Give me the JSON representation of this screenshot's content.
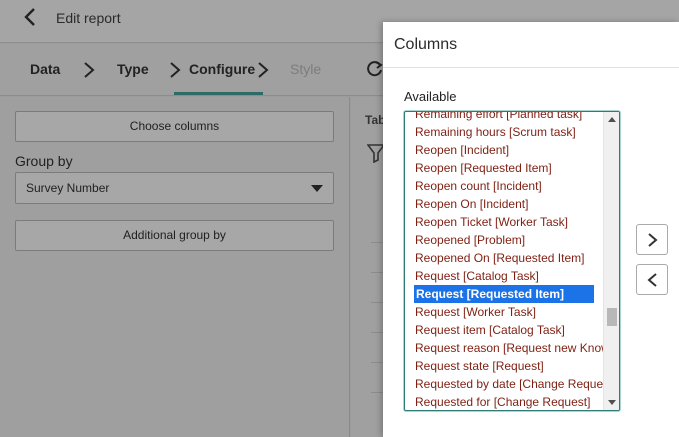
{
  "header": {
    "title": "Edit report"
  },
  "wizard": {
    "steps": [
      {
        "label": "Data"
      },
      {
        "label": "Type"
      },
      {
        "label": "Configure"
      },
      {
        "label": "Style"
      }
    ]
  },
  "left_panel": {
    "choose_columns_label": "Choose columns",
    "group_by_label": "Group by",
    "group_by_value": "Survey Number",
    "additional_group_label": "Additional group by"
  },
  "right_bg": {
    "tab_label_partial": "Tab"
  },
  "modal": {
    "title": "Columns",
    "available_label": "Available",
    "items": [
      "Remaining effort [Planned task]",
      "Remaining hours [Scrum task]",
      "Reopen [Incident]",
      "Reopen [Requested Item]",
      "Reopen count [Incident]",
      "Reopen On [Incident]",
      "Reopen Ticket [Worker Task]",
      "Reopened [Problem]",
      "Reopened On [Requested Item]",
      "Request [Catalog Task]",
      "Request [Requested Item]",
      "Request [Worker Task]",
      "Request item [Catalog Task]",
      "Request reason [Request new Knowledge Base]",
      "Request state [Request]",
      "Requested by date [Change Request]",
      "Requested for [Change Request]"
    ],
    "selected_index": 10
  },
  "colors": {
    "accent": "#2e6b66",
    "selection": "#1c73e8",
    "item_text": "#7f1f12"
  }
}
